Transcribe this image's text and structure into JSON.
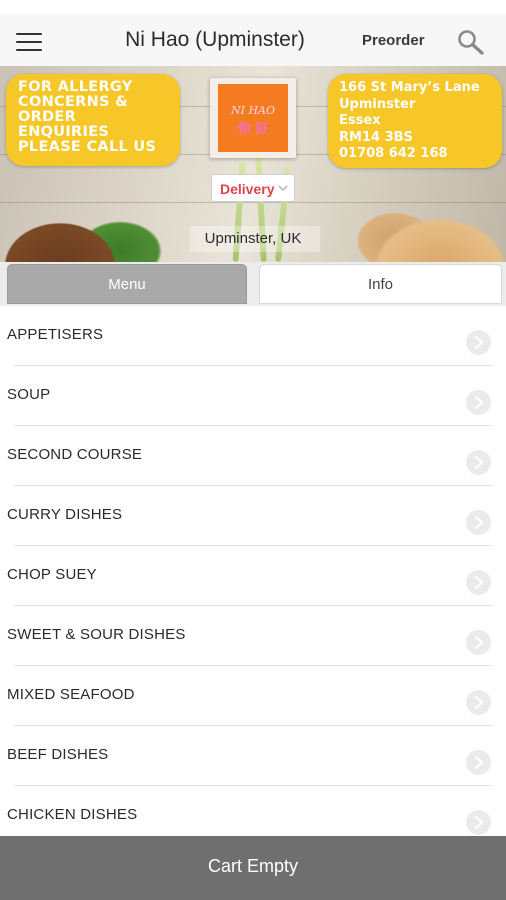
{
  "header": {
    "title": "Ni Hao (Upminster)",
    "preorder_label": "Preorder",
    "menu_icon": "hamburger-icon",
    "search_icon": "search-icon"
  },
  "banner": {
    "allergy_notice": [
      "FOR ALLERGY",
      "CONCERNS &",
      "ORDER",
      "ENQUIRIES",
      "PLEASE CALL US"
    ],
    "address": [
      "166 St Mary’s Lane",
      "Upminster",
      "Essex",
      "RM14 3BS",
      "01708 642 168"
    ],
    "order_type": "Delivery",
    "location": "Upminster, UK",
    "card_color": "#f7c72a",
    "logo_color": "#f47b20"
  },
  "tabs": [
    {
      "label": "Menu",
      "active": true
    },
    {
      "label": "Info",
      "active": false
    }
  ],
  "menu": {
    "categories": [
      "APPETISERS",
      "SOUP",
      "SECOND COURSE",
      "CURRY DISHES",
      "CHOP SUEY",
      "SWEET & SOUR DISHES",
      "MIXED SEAFOOD",
      "BEEF DISHES",
      "CHICKEN DISHES"
    ],
    "item_icon": "chevron-right-icon"
  },
  "cart": {
    "label": "Cart Empty",
    "bar_color": "#6f6f6f"
  }
}
